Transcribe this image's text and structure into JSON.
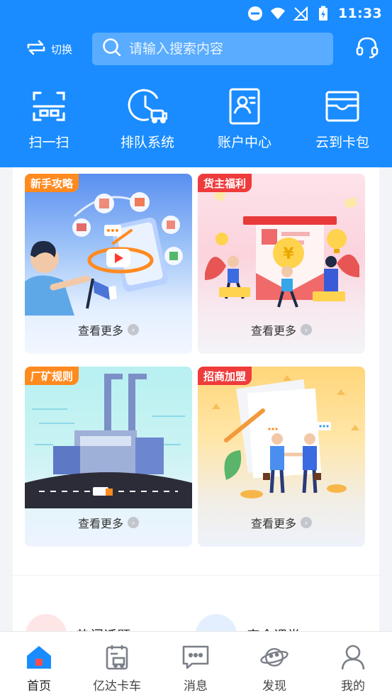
{
  "status_bar": {
    "time": "11:33"
  },
  "header": {
    "switch_label": "切换",
    "search_placeholder": "请输入搜索内容"
  },
  "quick_actions": [
    {
      "label": "扫一扫",
      "icon": "scan-icon"
    },
    {
      "label": "排队系统",
      "icon": "queue-clock-icon"
    },
    {
      "label": "账户中心",
      "icon": "account-card-icon"
    },
    {
      "label": "云到卡包",
      "icon": "wallet-icon"
    }
  ],
  "cards": [
    {
      "badge": "新手攻略",
      "more": "查看更多",
      "badge_color": "#ff8a1f"
    },
    {
      "badge": "货主福利",
      "more": "查看更多",
      "badge_color": "#ef3b3b"
    },
    {
      "badge": "厂矿规则",
      "more": "查看更多",
      "badge_color": "#ff8a1f"
    },
    {
      "badge": "招商加盟",
      "more": "查看更多",
      "badge_color": "#ef3b3b"
    }
  ],
  "topics": [
    {
      "label": "热门话题"
    },
    {
      "label": "安全课堂"
    }
  ],
  "tabbar": [
    {
      "label": "首页",
      "icon": "home-icon",
      "active": true
    },
    {
      "label": "亿达卡车",
      "icon": "truck-schedule-icon",
      "active": false
    },
    {
      "label": "消息",
      "icon": "message-icon",
      "active": false
    },
    {
      "label": "发现",
      "icon": "planet-icon",
      "active": false
    },
    {
      "label": "我的",
      "icon": "user-icon",
      "active": false
    }
  ],
  "colors": {
    "brand": "#1a8cff",
    "orange_badge": "#ff8a1f",
    "red_badge": "#ef3b3b"
  }
}
